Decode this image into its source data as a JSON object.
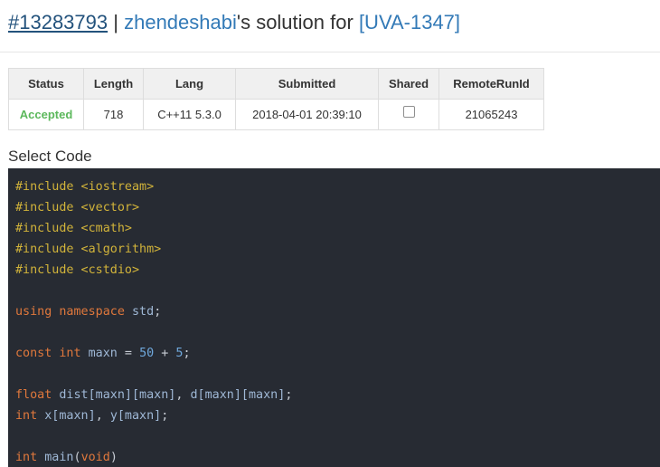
{
  "header": {
    "run_id": "#13283793",
    "separator": "|",
    "user": "zhendeshabi",
    "suffix": "'s solution for",
    "problem": "[UVA-1347]"
  },
  "table": {
    "headers": [
      "Status",
      "Length",
      "Lang",
      "Submitted",
      "Shared",
      "RemoteRunId"
    ],
    "row": {
      "status": "Accepted",
      "length": "718",
      "lang": "C++11 5.3.0",
      "submitted": "2018-04-01 20:39:10",
      "shared": false,
      "remote_run_id": "21065243"
    }
  },
  "select_label": "Select Code",
  "colors": {
    "accent_link": "#337ab7",
    "accepted": "#5cb85c",
    "code_bg": "#272b33"
  },
  "code_lines": [
    [
      {
        "t": "pp",
        "v": "#include <iostream>"
      }
    ],
    [
      {
        "t": "pp",
        "v": "#include <vector>"
      }
    ],
    [
      {
        "t": "pp",
        "v": "#include <cmath>"
      }
    ],
    [
      {
        "t": "pp",
        "v": "#include <algorithm>"
      }
    ],
    [
      {
        "t": "pp",
        "v": "#include <cstdio>"
      }
    ],
    [],
    [
      {
        "t": "kw",
        "v": "using"
      },
      {
        "t": "pl",
        "v": " "
      },
      {
        "t": "kw",
        "v": "namespace"
      },
      {
        "t": "pl",
        "v": " "
      },
      {
        "t": "id",
        "v": "std"
      },
      {
        "t": "pl",
        "v": ";"
      }
    ],
    [],
    [
      {
        "t": "kw",
        "v": "const"
      },
      {
        "t": "pl",
        "v": " "
      },
      {
        "t": "kw",
        "v": "int"
      },
      {
        "t": "pl",
        "v": " "
      },
      {
        "t": "id",
        "v": "maxn"
      },
      {
        "t": "pl",
        "v": " = "
      },
      {
        "t": "num",
        "v": "50"
      },
      {
        "t": "pl",
        "v": " + "
      },
      {
        "t": "num",
        "v": "5"
      },
      {
        "t": "pl",
        "v": ";"
      }
    ],
    [],
    [
      {
        "t": "kw",
        "v": "float"
      },
      {
        "t": "pl",
        "v": " "
      },
      {
        "t": "id",
        "v": "dist[maxn][maxn]"
      },
      {
        "t": "pl",
        "v": ", "
      },
      {
        "t": "id",
        "v": "d[maxn][maxn]"
      },
      {
        "t": "pl",
        "v": ";"
      }
    ],
    [
      {
        "t": "kw",
        "v": "int"
      },
      {
        "t": "pl",
        "v": " "
      },
      {
        "t": "id",
        "v": "x[maxn]"
      },
      {
        "t": "pl",
        "v": ", "
      },
      {
        "t": "id",
        "v": "y[maxn]"
      },
      {
        "t": "pl",
        "v": ";"
      }
    ],
    [],
    [
      {
        "t": "kw",
        "v": "int"
      },
      {
        "t": "pl",
        "v": " "
      },
      {
        "t": "id",
        "v": "main"
      },
      {
        "t": "pl",
        "v": "("
      },
      {
        "t": "kw",
        "v": "void"
      },
      {
        "t": "pl",
        "v": ")"
      }
    ]
  ]
}
